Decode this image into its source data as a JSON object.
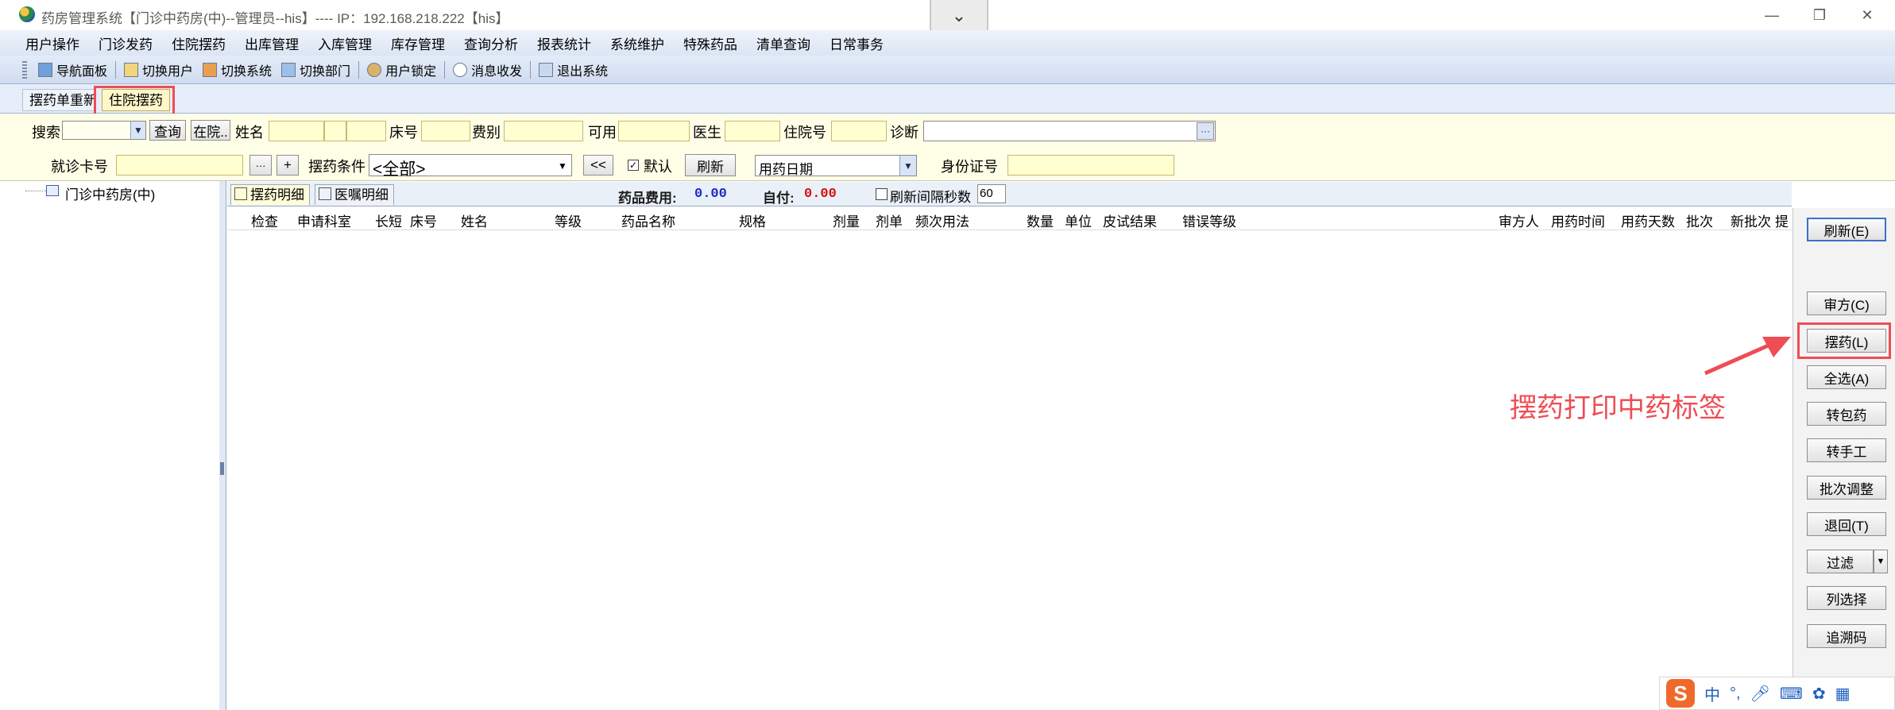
{
  "window": {
    "title": "药房管理系统【门诊中药房(中)--管理员--his】---- IP：192.168.218.222【his】",
    "controls": {
      "minimize": "—",
      "restore": "❐",
      "close": "✕"
    },
    "dropdown_glyph": "⌄"
  },
  "menu": [
    "用户操作",
    "门诊发药",
    "住院摆药",
    "出库管理",
    "入库管理",
    "库存管理",
    "查询分析",
    "报表统计",
    "系统维护",
    "特殊药品",
    "清单查询",
    "日常事务"
  ],
  "toolbar": [
    {
      "label": "导航面板",
      "icon": "navigation-panel-icon"
    },
    {
      "label": "切换用户",
      "icon": "switch-user-icon"
    },
    {
      "label": "切换系统",
      "icon": "switch-system-icon"
    },
    {
      "label": "切换部门",
      "icon": "switch-department-icon"
    },
    {
      "label": "用户锁定",
      "icon": "user-lock-icon"
    },
    {
      "label": "消息收发",
      "icon": "message-icon"
    },
    {
      "label": "退出系统",
      "icon": "exit-icon"
    }
  ],
  "tabs": {
    "record": "摆药单重新",
    "inpatient": "住院摆药"
  },
  "filter": {
    "search_label": "搜索",
    "query_button": "查询",
    "inpatient_button": "在院..",
    "name_label": "姓名",
    "bed_label": "床号",
    "fee_type_label": "费别",
    "available_label": "可用",
    "doctor_label": "医生",
    "admission_label": "住院号",
    "diagnosis_label": "诊断",
    "diagnosis_button": "···",
    "card_label": "就诊卡号",
    "ellipsis_button": "···",
    "plus_button": "+",
    "condition_label": "摆药条件",
    "condition_value": "<全部>",
    "back_button": "<<",
    "default_checkbox": "默认",
    "default_checked": true,
    "refresh_button": "刷新",
    "date_select": "用药日期",
    "id_label": "身份证号"
  },
  "tree": {
    "root": "门诊中药房(中)"
  },
  "detail": {
    "tab_detail": "摆药明细",
    "tab_orders": "医嘱明细",
    "drug_fee_label": "药品费用:",
    "drug_fee_value": "0.00",
    "self_pay_label": "自付:",
    "self_pay_value": "0.00",
    "refresh_interval_label": "刷新间隔秒数",
    "refresh_interval_value": "60"
  },
  "columns": [
    "检查",
    "申请科室",
    "长短",
    "床号",
    "姓名",
    "等级",
    "药品名称",
    "规格",
    "剂量",
    "剂单",
    "频次用法",
    "数量",
    "单位",
    "皮试结果",
    "错误等级",
    "审方人",
    "用药时间",
    "用药天数",
    "批次",
    "新批次",
    "提"
  ],
  "right_buttons": {
    "refresh": "刷新(E)",
    "review": "审方(C)",
    "dispense": "摆药(L)",
    "select_all": "全选(A)",
    "to_package": "转包药",
    "to_manual": "转手工",
    "batch_adjust": "批次调整",
    "return": "退回(T)",
    "filter": "过滤",
    "column_select": "列选择",
    "trace_code": "追溯码"
  },
  "annotation": {
    "text": "摆药打印中药标签",
    "color": "#ee4d55"
  },
  "ime": {
    "mode": "中",
    "punct": "°,"
  },
  "colors": {
    "accent_red": "#ee4d55",
    "field_yellow": "#ffffd2",
    "fee_blue": "#1a2dbf",
    "self_pay_red": "#d01010"
  }
}
